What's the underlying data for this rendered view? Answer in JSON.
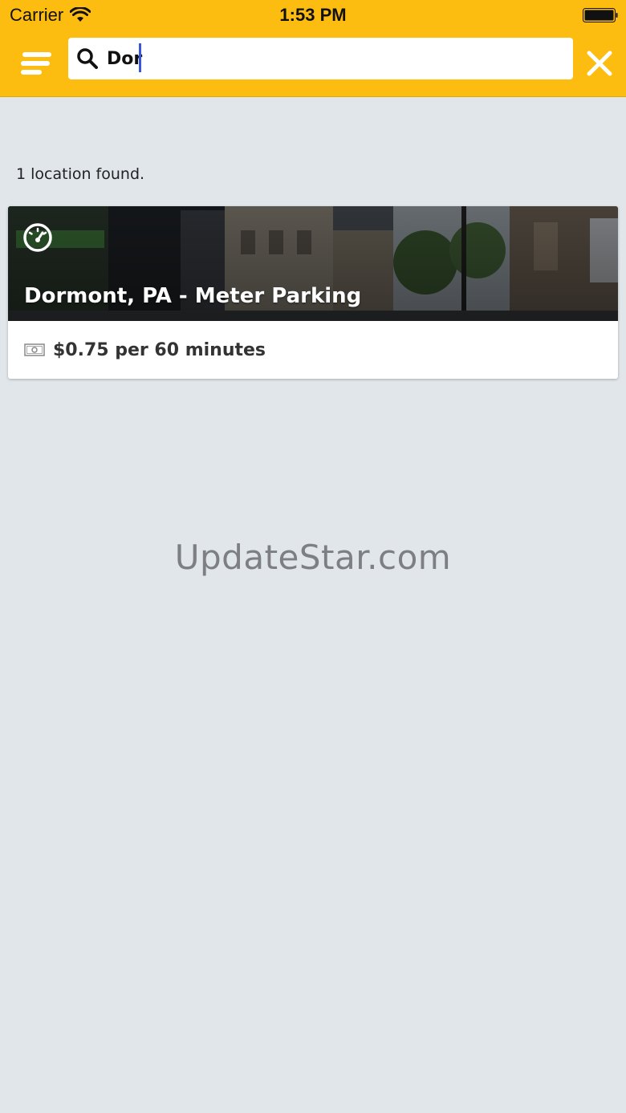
{
  "status_bar": {
    "carrier": "Carrier",
    "time": "1:53 PM",
    "wifi_icon": "wifi-icon",
    "battery_icon": "battery-icon"
  },
  "header": {
    "background_color": "#fdbd10",
    "menu_icon": "hamburger-menu-icon",
    "close_icon": "close-icon",
    "search": {
      "icon": "search-icon",
      "value": "Dor",
      "caret_color": "#3a56d4"
    }
  },
  "results": {
    "count_text": "1 location found.",
    "items": [
      {
        "title": "Dormont, PA - Meter Parking",
        "icon": "parking-meter-icon",
        "price_icon": "money-icon",
        "price": "$0.75 per 60 minutes"
      }
    ]
  },
  "watermark": "UpdateStar.com"
}
